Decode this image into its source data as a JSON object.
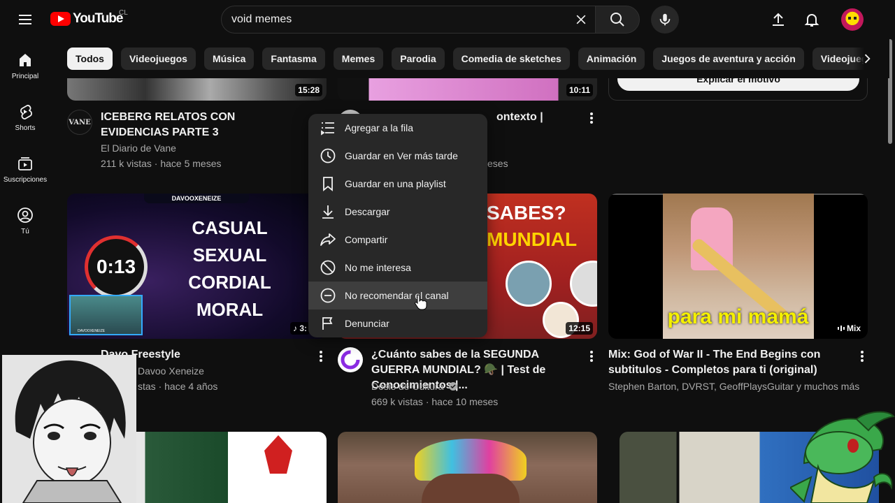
{
  "header": {
    "logo_text": "YouTube",
    "country_code": "CL",
    "search_value": "void memes"
  },
  "sidebar": {
    "items": [
      {
        "label": "Principal",
        "icon": "home-icon"
      },
      {
        "label": "Shorts",
        "icon": "shorts-icon"
      },
      {
        "label": "Suscripciones",
        "icon": "subscriptions-icon"
      },
      {
        "label": "Tú",
        "icon": "you-icon"
      }
    ]
  },
  "chips": [
    "Todos",
    "Videojuegos",
    "Música",
    "Fantasma",
    "Memes",
    "Parodia",
    "Comedia de sketches",
    "Animación",
    "Juegos de aventura y acción",
    "Videojuego ind"
  ],
  "row1": {
    "v1": {
      "duration": "15:28",
      "title": "ICEBERG RELATOS CON EVIDENCIAS PARTE 3",
      "channel": "El Diario de Vane",
      "meta": "211 k vistas · hace 5 meses",
      "avatar_text": "VANE"
    },
    "v2": {
      "duration": "10:11",
      "title_visible": "ontexto |",
      "meta_visible": "eses"
    },
    "v3": {
      "button_text": "Explicar el motivo"
    }
  },
  "row2": {
    "v1": {
      "thumb_header": "DAVOOXENEIZE",
      "thumb_timer": "0:13",
      "thumb_lines": [
        "CASUAL",
        "SEXUAL",
        "CORDIAL",
        "MORAL"
      ],
      "duration_visible": "3:",
      "title": "Davo Freestyle",
      "channel": "Davoo Xeneize",
      "meta": "stas · hace 4 años",
      "cam_label": "DAVOOXENEIZE"
    },
    "v2": {
      "thumb_line1": "SABES?",
      "thumb_line2": "MUNDIAL",
      "duration": "12:15",
      "title": "¿Cuánto sabes de la SEGUNDA GUERRA MUNDIAL? 🪖 | Test de Conocimientos |...",
      "channel": "Dosis de Cultura",
      "meta": "669 k vistas · hace 10 meses"
    },
    "v3": {
      "thumb_caption": "para mi mamá",
      "badge": "Mix",
      "title": "Mix: God of War II - The End Begins con subtitulos - Completos para ti (original)",
      "channel": "Stephen Barton, DVRST, GeoffPlaysGuitar y muchos más"
    }
  },
  "context_menu": {
    "items": [
      {
        "label": "Agregar a la fila",
        "icon": "queue-icon"
      },
      {
        "label": "Guardar en Ver más tarde",
        "icon": "clock-icon"
      },
      {
        "label": "Guardar en una playlist",
        "icon": "bookmark-icon"
      },
      {
        "label": "Descargar",
        "icon": "download-icon"
      },
      {
        "label": "Compartir",
        "icon": "share-icon"
      },
      {
        "label": "No me interesa",
        "icon": "block-icon"
      },
      {
        "label": "No recomendar el canal",
        "icon": "minus-circle-icon"
      },
      {
        "label": "Denunciar",
        "icon": "flag-icon"
      }
    ]
  },
  "colors": {
    "background": "#0f0f0f",
    "menu_bg": "#282828",
    "chip_bg": "#272727",
    "brand_red": "#ff0000",
    "meta_text": "#aaaaaa"
  }
}
